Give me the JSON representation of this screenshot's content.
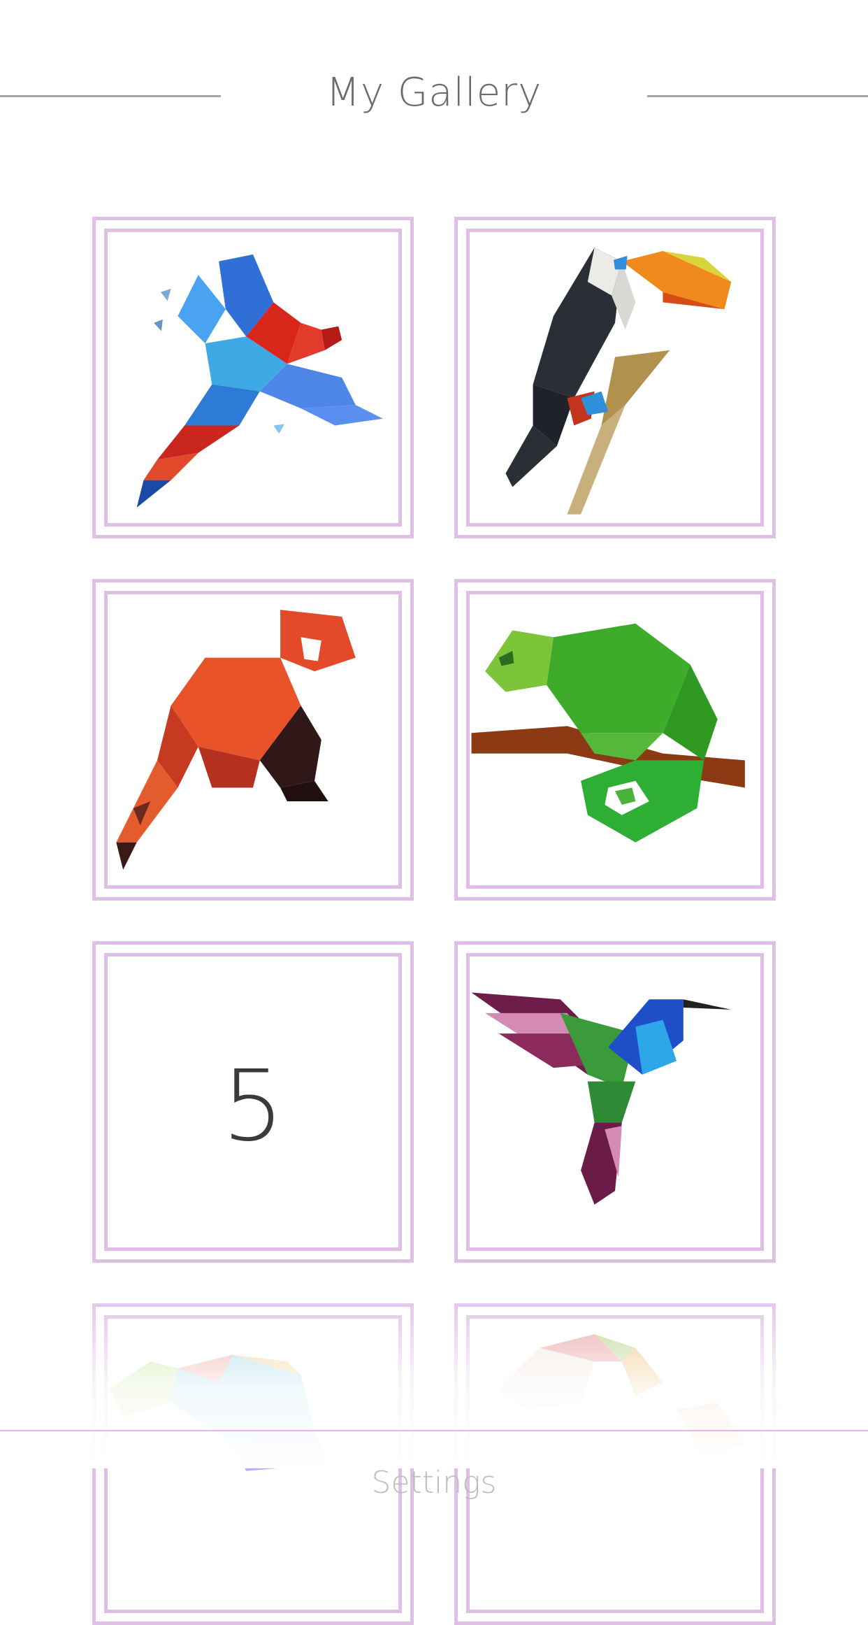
{
  "header": {
    "title": "My Gallery"
  },
  "gallery": {
    "items": [
      {
        "subject": "parrot-icon"
      },
      {
        "subject": "toucan-icon"
      },
      {
        "subject": "red-panda-icon"
      },
      {
        "subject": "chameleon-icon"
      },
      {
        "subject": "number-placeholder",
        "label": "5"
      },
      {
        "subject": "hummingbird-icon"
      },
      {
        "subject": "rainbow-chameleon-icon"
      },
      {
        "subject": "unicorn-icon"
      }
    ]
  },
  "footer": {
    "settings_label": "Settings"
  },
  "colors": {
    "frame": "#e0bfe7",
    "divider": "#e3b7e8",
    "title": "#6b6b6b",
    "header_line": "#a7a7a7"
  }
}
